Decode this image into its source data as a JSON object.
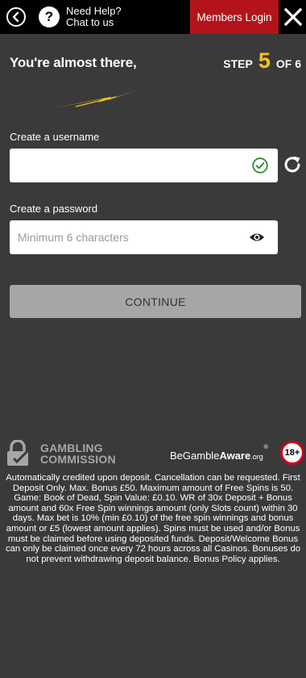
{
  "header": {
    "help_line1": "Need Help?",
    "help_line2": "Chat to us",
    "help_icon_glyph": "?",
    "members_login": "Members Login"
  },
  "heading": "You're almost there,",
  "step": {
    "prefix": "STEP",
    "current": "5",
    "suffix": "OF 6"
  },
  "username": {
    "label": "Create a username",
    "value": "",
    "placeholder": ""
  },
  "password": {
    "label": "Create a password",
    "value": "",
    "placeholder": "Minimum 6 characters"
  },
  "continue_label": "CONTINUE",
  "footer": {
    "gc_line1": "GAMBLING",
    "gc_line2": "COMMISSION",
    "bga_part1": "Be",
    "bga_part2": "Gamble",
    "bga_part3": "Aware",
    "bga_org": ".org",
    "bga_reg": "®",
    "age": "18+",
    "terms": "Automatically credited upon deposit. Cancellation can be requested. First Deposit Only. Max. Bonus £50. Maximum amount of Free Spins is 50. Game: Book of Dead, Spin Value: £0.10. WR of 30x Deposit + Bonus amount and 60x Free Spin winnings amount (only Slots count) within 30 days. Max bet is 10% (min £0.10) of the free spin winnings and bonus amount or £5 (lowest amount applies). Spins must be used and/or Bonus must be claimed before using deposited funds. Deposit/Welcome Bonus can only be claimed once every 72 hours across all Casinos. Bonuses do not prevent withdrawing deposit balance. Bonus Policy applies."
  },
  "colors": {
    "accent_yellow": "#f5c518",
    "login_red": "#b3141c",
    "success_green": "#2e8b2e",
    "background": "#3a3a3a"
  },
  "icons": [
    "back-arrow-icon",
    "help-icon",
    "close-icon",
    "lightning-bolt-icon",
    "check-circle-icon",
    "refresh-icon",
    "eye-icon",
    "padlock-icon"
  ]
}
